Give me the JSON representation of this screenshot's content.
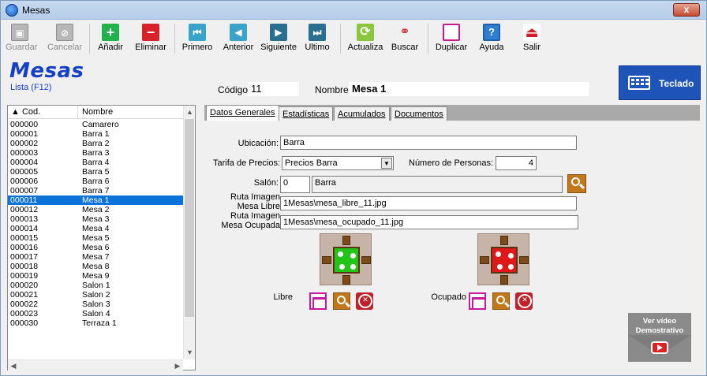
{
  "window": {
    "title": "Mesas",
    "close_symbol": "x"
  },
  "toolbar": {
    "items": [
      {
        "id": "guardar",
        "label": "Guardar",
        "icon": "save-icon",
        "enabled": false
      },
      {
        "id": "cancelar",
        "label": "Cancelar",
        "icon": "cancel-icon",
        "enabled": false
      },
      {
        "id": "anadir",
        "label": "Añadir",
        "icon": "plus-icon",
        "enabled": true
      },
      {
        "id": "eliminar",
        "label": "Eliminar",
        "icon": "minus-icon",
        "enabled": true
      },
      {
        "id": "primero",
        "label": "Primero",
        "icon": "first-icon",
        "enabled": true
      },
      {
        "id": "anterior",
        "label": "Anterior",
        "icon": "previous-icon",
        "enabled": true
      },
      {
        "id": "siguiente",
        "label": "Siguiente",
        "icon": "next-icon",
        "enabled": true
      },
      {
        "id": "ultimo",
        "label": "Ultimo",
        "icon": "last-icon",
        "enabled": true
      },
      {
        "id": "actualiza",
        "label": "Actualiza",
        "icon": "refresh-icon",
        "enabled": true
      },
      {
        "id": "buscar",
        "label": "Buscar",
        "icon": "binoculars-icon",
        "enabled": true
      },
      {
        "id": "duplicar",
        "label": "Duplicar",
        "icon": "duplicate-icon",
        "enabled": true
      },
      {
        "id": "ayuda",
        "label": "Ayuda",
        "icon": "help-icon",
        "enabled": true
      },
      {
        "id": "salir",
        "label": "Salir",
        "icon": "exit-icon",
        "enabled": true
      }
    ]
  },
  "header": {
    "heading": "Mesas",
    "subtitle": "Lista (F12)",
    "codigo_label": "Código:",
    "codigo_value": "11",
    "nombre_label": "Nombre:",
    "nombre_value": "Mesa 1",
    "teclado_label": "Teclado"
  },
  "list": {
    "col_cod": "Cod.",
    "col_nombre": "Nombre",
    "selected_index": 8,
    "rows": [
      {
        "cod": "000000",
        "nombre": "Camarero"
      },
      {
        "cod": "000001",
        "nombre": "Barra 1"
      },
      {
        "cod": "000002",
        "nombre": "Barra 2"
      },
      {
        "cod": "000003",
        "nombre": "Barra 3"
      },
      {
        "cod": "000004",
        "nombre": "Barra 4"
      },
      {
        "cod": "000005",
        "nombre": "Barra 5"
      },
      {
        "cod": "000006",
        "nombre": "Barra 6"
      },
      {
        "cod": "000007",
        "nombre": "Barra 7"
      },
      {
        "cod": "000011",
        "nombre": "Mesa 1"
      },
      {
        "cod": "000012",
        "nombre": "Mesa 2"
      },
      {
        "cod": "000013",
        "nombre": "Mesa 3"
      },
      {
        "cod": "000014",
        "nombre": "Mesa 4"
      },
      {
        "cod": "000015",
        "nombre": "Mesa 5"
      },
      {
        "cod": "000016",
        "nombre": "Mesa 6"
      },
      {
        "cod": "000017",
        "nombre": "Mesa 7"
      },
      {
        "cod": "000018",
        "nombre": "Mesa 8"
      },
      {
        "cod": "000019",
        "nombre": "Mesa 9"
      },
      {
        "cod": "000020",
        "nombre": "Salon 1"
      },
      {
        "cod": "000021",
        "nombre": "Salon 2"
      },
      {
        "cod": "000022",
        "nombre": "Salon 3"
      },
      {
        "cod": "000023",
        "nombre": "Salon 4"
      },
      {
        "cod": "000030",
        "nombre": "Terraza 1"
      }
    ]
  },
  "tabs": [
    {
      "label": "Datos Generales",
      "active": true
    },
    {
      "label": "Estadísticas",
      "active": false
    },
    {
      "label": "Acumulados",
      "active": false
    },
    {
      "label": "Documentos",
      "active": false
    }
  ],
  "form": {
    "ubicacion_label": "Ubicación:",
    "ubicacion_value": "Barra",
    "tarifa_label": "Tarifa de Precios:",
    "tarifa_value": "Precios Barra",
    "personas_label": "Número de Personas:",
    "personas_value": "4",
    "salon_label": "Salón:",
    "salon_code": "0",
    "salon_name": "Barra",
    "ruta_libre_label_1": "Ruta Imagen",
    "ruta_libre_label_2": "Mesa Libre",
    "ruta_libre_value": "1Mesas\\mesa_libre_11.jpg",
    "ruta_ocupada_label_1": "Ruta Imagen",
    "ruta_ocupada_label_2": "Mesa Ocupada",
    "ruta_ocupada_value": "1Mesas\\mesa_ocupado_11.jpg",
    "libre_label": "Libre",
    "ocupado_label": "Ocupado",
    "libre_color": "#22c41a",
    "ocupado_color": "#e01818"
  },
  "video": {
    "line1": "Ver vídeo",
    "line2": "Demostrativo"
  }
}
